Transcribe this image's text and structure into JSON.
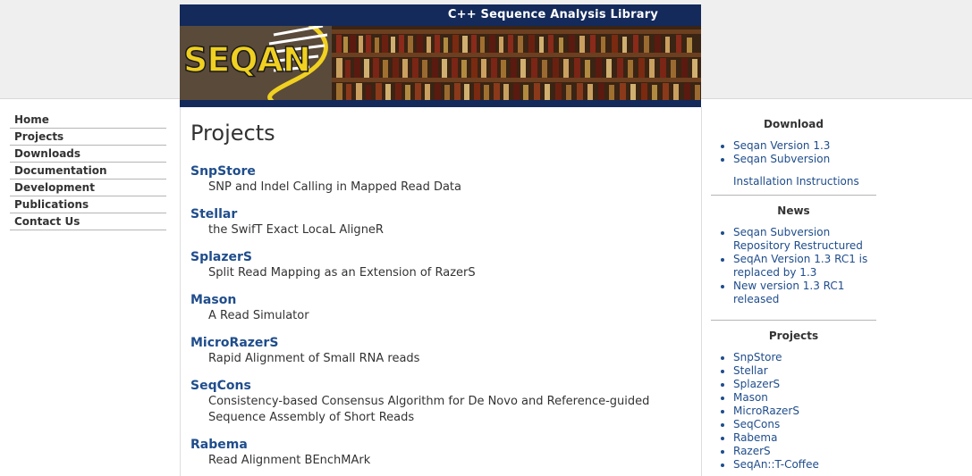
{
  "header": {
    "tagline": "C++ Sequence Analysis Library",
    "logo_text": "SEQAN"
  },
  "nav": [
    {
      "label": "Home"
    },
    {
      "label": "Projects"
    },
    {
      "label": "Downloads"
    },
    {
      "label": "Documentation"
    },
    {
      "label": "Development"
    },
    {
      "label": "Publications"
    },
    {
      "label": "Contact Us"
    }
  ],
  "main": {
    "title": "Projects",
    "projects": [
      {
        "name": "SnpStore",
        "desc": "SNP and Indel Calling in Mapped Read Data"
      },
      {
        "name": "Stellar",
        "desc": "the SwifT Exact LocaL AligneR"
      },
      {
        "name": "SplazerS",
        "desc": "Split Read Mapping as an Extension of RazerS"
      },
      {
        "name": "Mason",
        "desc": "A Read Simulator"
      },
      {
        "name": "MicroRazerS",
        "desc": "Rapid Alignment of Small RNA reads"
      },
      {
        "name": "SeqCons",
        "desc": "Consistency-based Consensus Algorithm for De Novo and Reference-guided Sequence Assembly of Short Reads"
      },
      {
        "name": "Rabema",
        "desc": "Read Alignment BEnchMArk"
      }
    ]
  },
  "sidebar": {
    "download": {
      "heading": "Download",
      "items": [
        "Seqan Version 1.3",
        "Seqan Subversion"
      ],
      "extra_link": "Installation Instructions"
    },
    "news": {
      "heading": "News",
      "items": [
        "Seqan Subversion Repository Restructured",
        "SeqAn Version 1.3 RC1 is replaced by 1.3",
        "New version 1.3 RC1 released"
      ]
    },
    "projects": {
      "heading": "Projects",
      "items": [
        "SnpStore",
        "Stellar",
        "SplazerS",
        "Mason",
        "MicroRazerS",
        "SeqCons",
        "Rabema",
        "RazerS",
        "SeqAn::T-Coffee"
      ]
    }
  },
  "colors": {
    "link": "#1f4d8c",
    "header_bar": "#132a5b",
    "logo": "#f0d020"
  }
}
